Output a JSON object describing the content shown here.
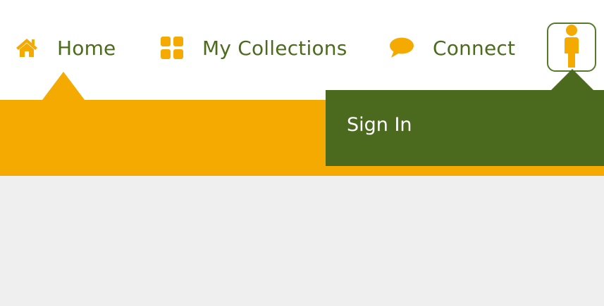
{
  "nav": {
    "items": [
      {
        "label": "Home",
        "icon": "home-icon"
      },
      {
        "label": "My Collections",
        "icon": "grid-icon"
      },
      {
        "label": "Connect",
        "icon": "chat-bubble-icon"
      }
    ],
    "active": "Home"
  },
  "user_menu": {
    "avatar_icon": "person-icon",
    "items": [
      {
        "label": "Sign In"
      }
    ]
  },
  "colors": {
    "accent": "#f4aa00",
    "brand_green": "#4b6a1d",
    "nav_text": "#4d6b1e",
    "content_bg": "#efefef"
  }
}
